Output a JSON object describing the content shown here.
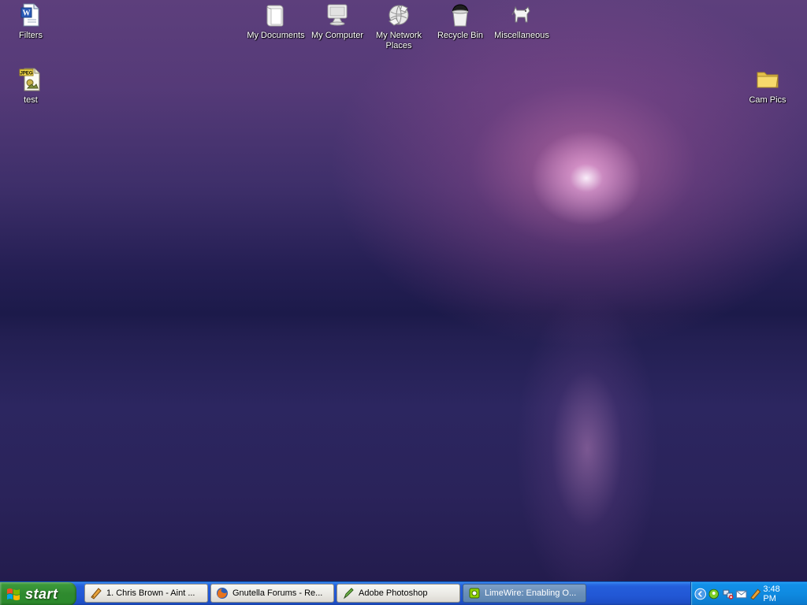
{
  "desktop": {
    "icons": [
      {
        "label": "Filters",
        "icon": "word-document-icon"
      },
      {
        "label": "test",
        "icon": "jpeg-file-icon",
        "badge": "JPEG"
      },
      {
        "label": "My Documents",
        "icon": "my-documents-icon"
      },
      {
        "label": "My Computer",
        "icon": "my-computer-icon"
      },
      {
        "label": "My Network Places",
        "icon": "network-places-icon"
      },
      {
        "label": "Recycle Bin",
        "icon": "recycle-bin-icon"
      },
      {
        "label": "Miscellaneous",
        "icon": "dog-icon"
      },
      {
        "label": "Cam Pics",
        "icon": "folder-icon"
      }
    ]
  },
  "taskbar": {
    "start_label": "start",
    "tasks": [
      {
        "label": "1. Chris Brown - Aint ...",
        "icon": "winamp-icon",
        "active": false
      },
      {
        "label": "Gnutella Forums - Re...",
        "icon": "firefox-icon",
        "active": false
      },
      {
        "label": "Adobe Photoshop",
        "icon": "photoshop-icon",
        "active": false
      },
      {
        "label": "LimeWire: Enabling O...",
        "icon": "limewire-icon",
        "active": true
      }
    ],
    "tray": {
      "icons": [
        "show-hidden-icons-icon",
        "messenger-icon",
        "network-icon",
        "mail-icon",
        "winamp-icon"
      ],
      "clock": "3:48 PM"
    }
  },
  "colors": {
    "taskbar_blue": "#245edb",
    "start_green": "#2f8a2f",
    "tray_blue": "#0f8ae0"
  }
}
